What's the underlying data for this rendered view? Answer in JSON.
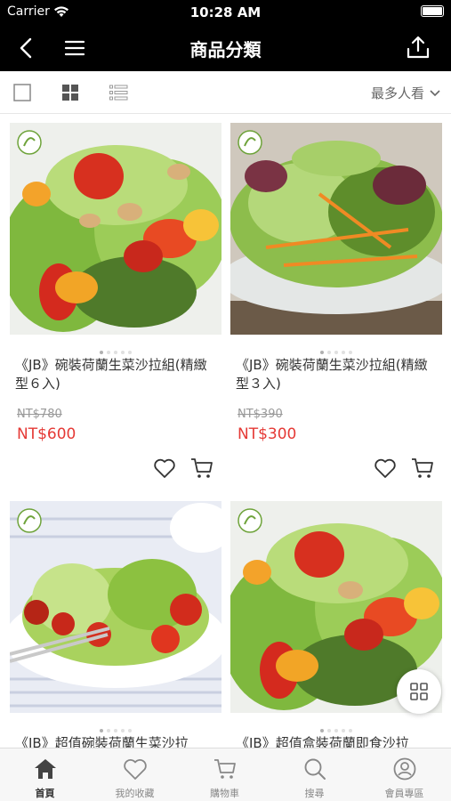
{
  "status_bar": {
    "carrier": "Carrier",
    "time": "10:28 AM"
  },
  "nav": {
    "title": "商品分類"
  },
  "toolbar": {
    "sort_label": "最多人看"
  },
  "products": [
    {
      "name": "《JB》碗裝荷蘭生菜沙拉組(精緻型６入)",
      "original_price": "NT$780",
      "price": "NT$600"
    },
    {
      "name": "《JB》碗裝荷蘭生菜沙拉組(精緻型３入)",
      "original_price": "NT$390",
      "price": "NT$300"
    },
    {
      "name": "《JB》超值碗裝荷蘭生菜沙拉",
      "original_price": "",
      "price": ""
    },
    {
      "name": "《JB》超值盒裝荷蘭即食沙拉",
      "original_price": "",
      "price": ""
    }
  ],
  "tabbar": {
    "home": "首頁",
    "favorites": "我的收藏",
    "cart": "購物車",
    "search": "搜尋",
    "member": "會員專區"
  },
  "colors": {
    "accent_price": "#e53935",
    "header_bg": "#000000"
  },
  "icons": [
    "back-icon",
    "menu-icon",
    "share-icon",
    "grid-icon",
    "list-icon",
    "heart-icon",
    "cart-icon",
    "home-icon",
    "search-icon",
    "member-icon"
  ]
}
